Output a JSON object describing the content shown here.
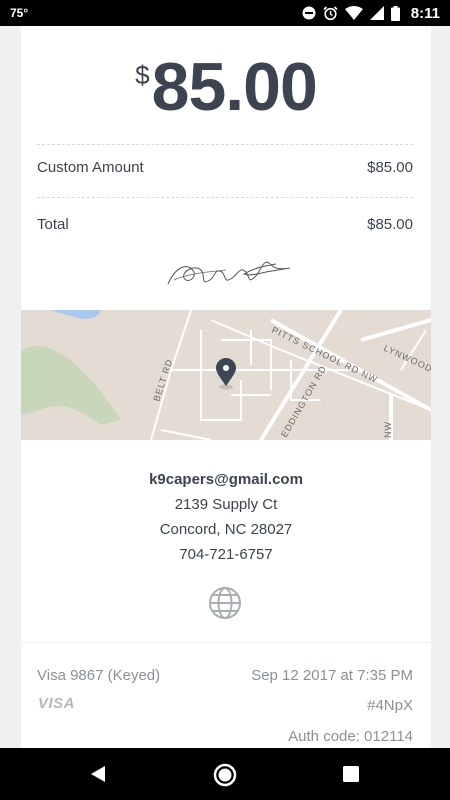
{
  "status_bar": {
    "temperature": "75°",
    "time": "8:11",
    "icons": [
      "do-not-disturb-icon",
      "alarm-icon",
      "wifi-icon",
      "signal-icon",
      "battery-icon"
    ]
  },
  "receipt": {
    "currency_symbol": "$",
    "amount": "85.00",
    "line_items": [
      {
        "label": "Custom Amount",
        "value": "$85.00"
      }
    ],
    "total": {
      "label": "Total",
      "value": "$85.00"
    }
  },
  "map": {
    "labels": {
      "pitts_school_rd": "PITTS SCHOOL RD NW",
      "lynwood": "LYNWOOD",
      "belt_rd": "BELT RD",
      "eddington_rd": "EDDINGTON RD",
      "nw": "NW"
    },
    "colors": {
      "land": "#e4dcd2",
      "water": "#a8c8f0",
      "park": "#c6d6b8",
      "road": "#ffffff",
      "pin": "#3d4654"
    }
  },
  "merchant": {
    "email": "k9capers@gmail.com",
    "address_line1": "2139 Supply Ct",
    "address_line2": "Concord, NC 28027",
    "phone": "704-721-6757"
  },
  "payment": {
    "card": "Visa 9867 (Keyed)",
    "date": "Sep 12 2017 at 7:35 PM",
    "brand": "VISA",
    "receipt_id": "#4NpX",
    "auth_code": "Auth code: 012114"
  }
}
